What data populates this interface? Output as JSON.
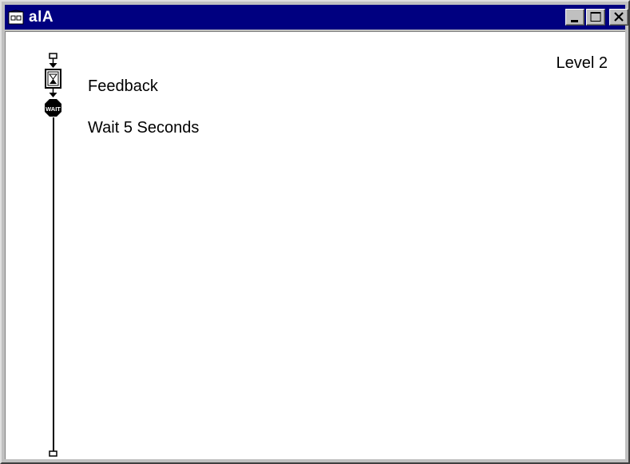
{
  "window": {
    "title": "alA",
    "title_icon": "map-icon",
    "buttons": [
      "minimize",
      "maximize",
      "close"
    ]
  },
  "content": {
    "level_label": "Level 2",
    "nodes": [
      {
        "icon": "display-icon",
        "label": "Feedback"
      },
      {
        "icon": "wait-icon",
        "badge": "WAIT",
        "label": "Wait 5 Seconds"
      }
    ]
  },
  "colors": {
    "titlebar": "#000080",
    "chrome": "#c0c0c0",
    "canvas": "#ffffff"
  }
}
